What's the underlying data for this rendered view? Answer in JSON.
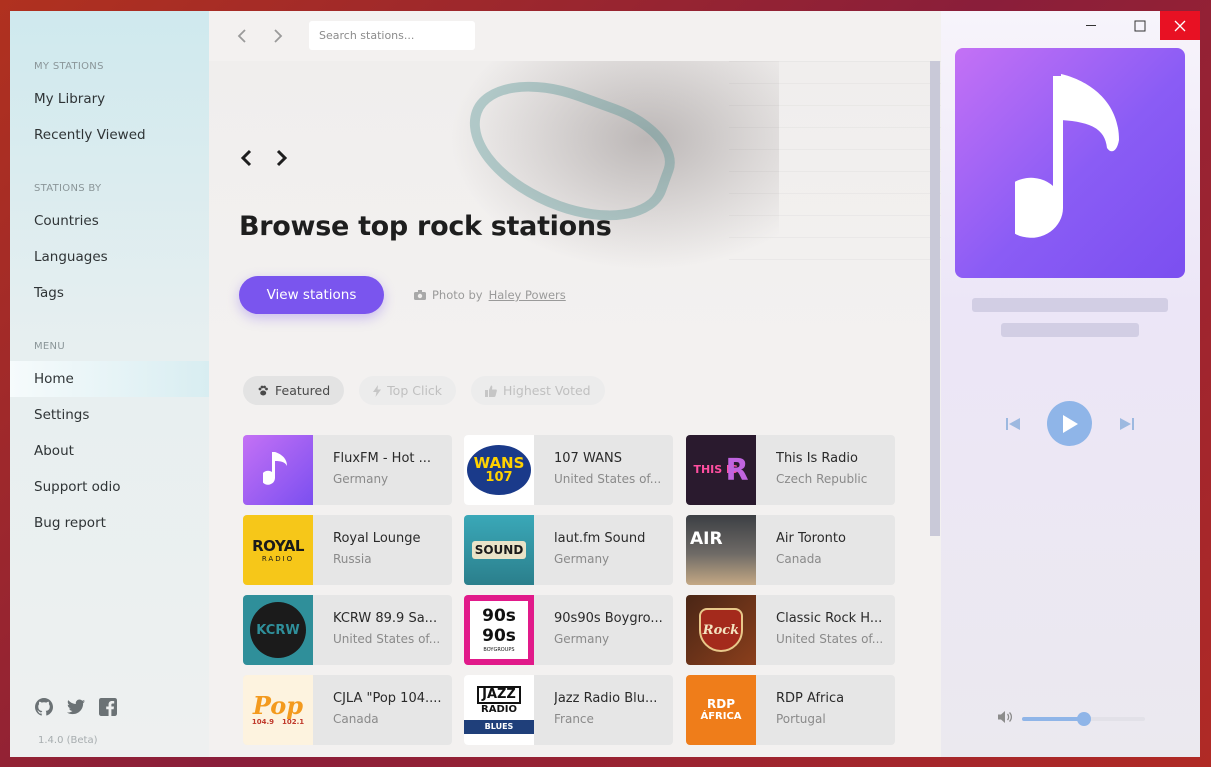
{
  "sidebar": {
    "sections": {
      "my_stations": "MY STATIONS",
      "stations_by": "STATIONS BY",
      "menu": "MENU"
    },
    "my_stations": [
      "My Library",
      "Recently Viewed"
    ],
    "stations_by": [
      "Countries",
      "Languages",
      "Tags"
    ],
    "menu": [
      "Home",
      "Settings",
      "About",
      "Support odio",
      "Bug report"
    ],
    "active_item": "Home",
    "footer_icons": [
      "github-icon",
      "twitter-icon",
      "facebook-icon"
    ],
    "version": "1.4.0 (Beta)"
  },
  "topbar": {
    "search_placeholder": "Search stations..."
  },
  "hero": {
    "title": "Browse top rock stations",
    "button_label": "View stations",
    "photo_by": "Photo by",
    "photo_author": "Haley Powers"
  },
  "tabs": [
    {
      "label": "Featured",
      "icon": "paw-icon",
      "active": true
    },
    {
      "label": "Top Click",
      "icon": "bolt-icon",
      "active": false
    },
    {
      "label": "Highest Voted",
      "icon": "thumbs-up-icon",
      "active": false
    }
  ],
  "stations": [
    {
      "name": "FluxFM - Hot ...",
      "country": "Germany"
    },
    {
      "name": "107 WANS",
      "country": "United States of..."
    },
    {
      "name": "This Is Radio",
      "country": "Czech Republic"
    },
    {
      "name": "Royal Lounge",
      "country": "Russia"
    },
    {
      "name": "laut.fm Sound",
      "country": "Germany"
    },
    {
      "name": "Air Toronto",
      "country": "Canada"
    },
    {
      "name": "KCRW 89.9 Sa...",
      "country": "United States of..."
    },
    {
      "name": "90s90s Boygro...",
      "country": "Germany"
    },
    {
      "name": "Classic Rock H...",
      "country": "United States of..."
    },
    {
      "name": "CJLA \"Pop 104....",
      "country": "Canada"
    },
    {
      "name": "Jazz Radio Blu...",
      "country": "France"
    },
    {
      "name": "RDP África",
      "country": "Portugal"
    }
  ],
  "thumb_text": {
    "wans": "WANS",
    "wans_num": "107",
    "thisis": "THIS IS",
    "royal": "ROYAL",
    "royal_sub": "RADIO",
    "sound": "SOUND",
    "air": "AIR",
    "kcrw": "KCRW",
    "s90a": "90s",
    "s90b": "90s",
    "s90c": "BOYGROUPS",
    "rock": "Rock",
    "pop": "Pop",
    "pop_left": "104.9",
    "pop_right": "102.1",
    "jazz1": "JAZZ",
    "jazz2": "RADIO",
    "jazz3": "BLUES",
    "rdp": "RDP",
    "africa": "ÁFRICA"
  },
  "player": {
    "volume": 0.5
  },
  "colors": {
    "accent": "#7a55ee",
    "player_blue": "#8fb5e8",
    "close_red": "#e81123"
  }
}
